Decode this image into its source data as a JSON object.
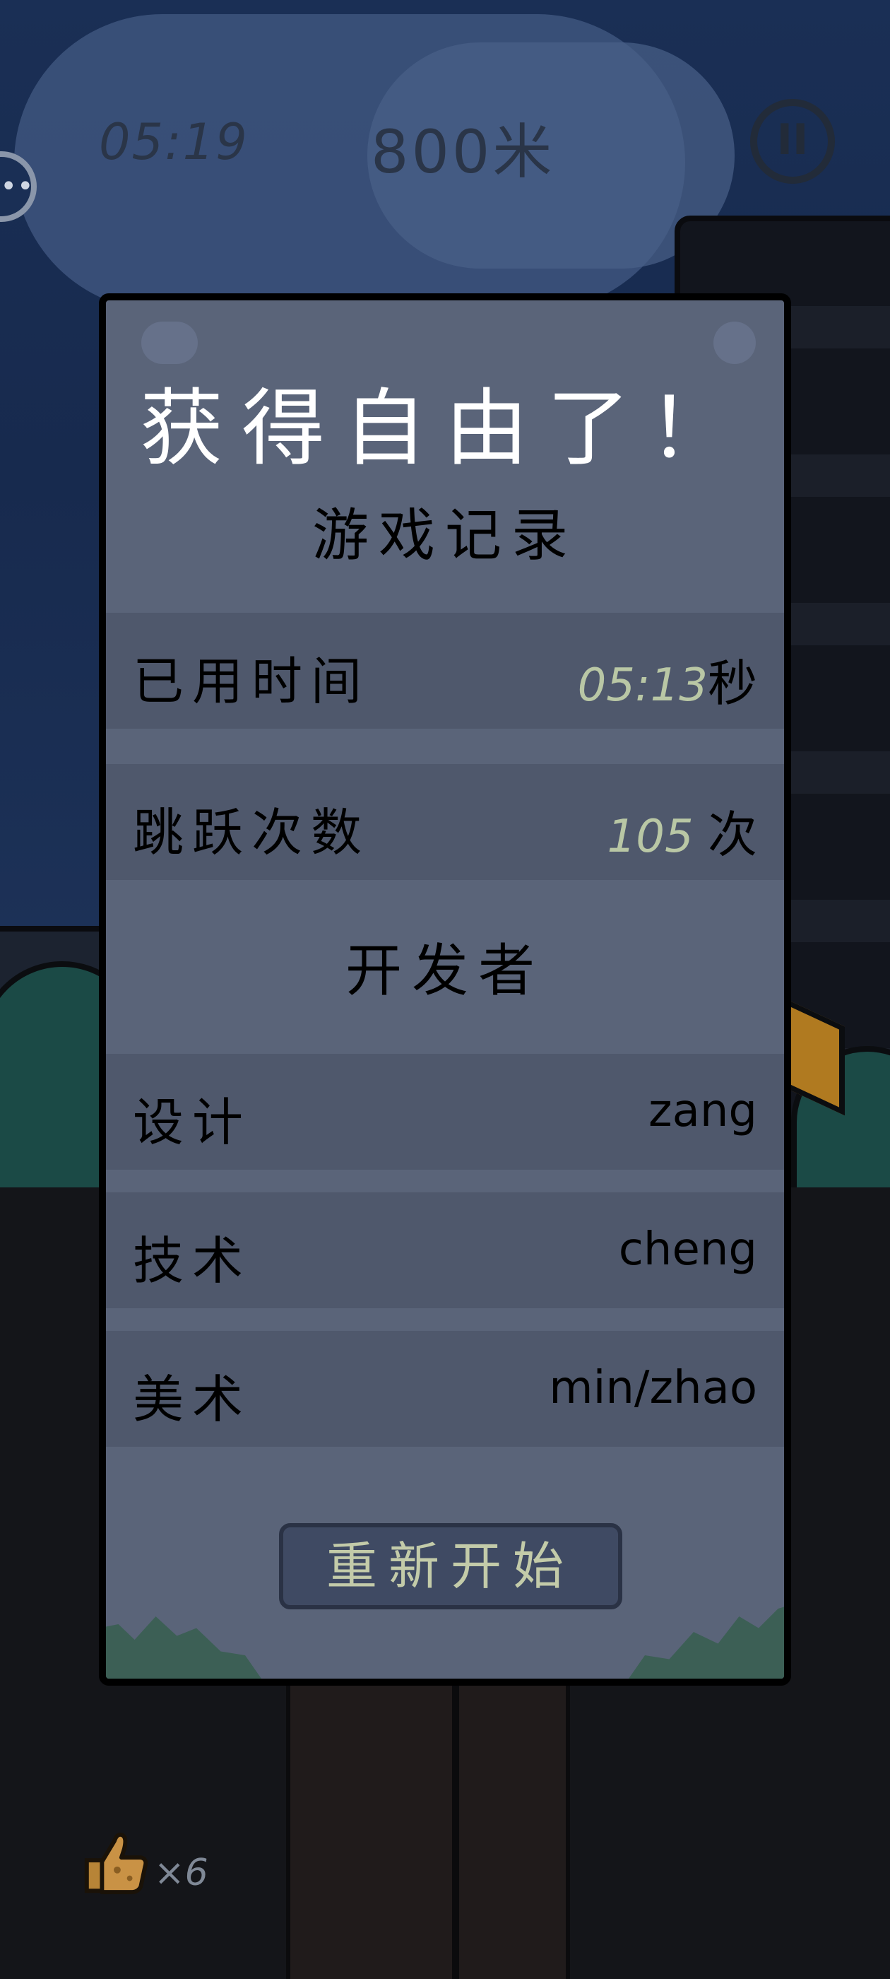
{
  "hud": {
    "time": "05:19",
    "distance": "800米",
    "pause_symbol": "II",
    "chat_symbol": "••"
  },
  "inventory": {
    "count": "×6"
  },
  "dialog": {
    "title": "获得自由了！",
    "record_heading": "游戏记录",
    "stats": [
      {
        "label": "已用时间",
        "value": "05:13",
        "unit": "秒"
      },
      {
        "label": "跳跃次数",
        "value": "105",
        "unit": "次"
      }
    ],
    "dev_heading": "开发者",
    "credits": [
      {
        "role": "设计",
        "name": "zang"
      },
      {
        "role": "技术",
        "name": "cheng"
      },
      {
        "role": "美术",
        "name": "min/zhao"
      }
    ],
    "restart_label": "重新开始"
  },
  "colors": {
    "dialog_bg": "#5a6479",
    "row_bg": "#4f586c",
    "stat_value": "#b9c7a5",
    "button_bg": "#3f4a63",
    "button_text": "#c3cba9"
  },
  "icons": {
    "pause": "pause-icon",
    "chat": "chat-icon",
    "thumb": "thumbs-up-icon"
  }
}
